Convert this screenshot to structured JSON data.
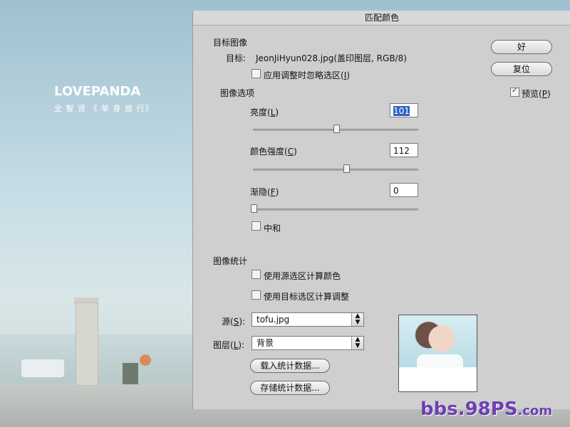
{
  "background": {
    "brand": "LOVEPANDA",
    "brand_sub": "全 智 贤  《 单 身 旅 行》"
  },
  "dialog": {
    "title": "匹配颜色",
    "target_section": "目标图像",
    "target_label": "目标:",
    "target_value": "JeonJiHyun028.jpg(盖印图层, RGB/8)",
    "ignore_selection_label": "应用调整时忽略选区(",
    "ignore_selection_key": "I",
    "image_options_section": "图像选项",
    "brightness_label": "亮度(",
    "brightness_key": "L",
    "brightness_value": "101",
    "brightness_level": 0.5,
    "intensity_label": "颜色强度(",
    "intensity_key": "C",
    "intensity_value": "112",
    "intensity_level": 0.56,
    "fade_label": "渐隐(",
    "fade_key": "F",
    "fade_value": "0",
    "fade_level": 0,
    "neutralize_label": "中和",
    "stats_section": "图像统计",
    "use_source_sel_label": "使用源选区计算颜色",
    "use_target_sel_label": "使用目标选区计算调整",
    "source_label": "源(",
    "source_key": "S",
    "source_value": "tofu.jpg",
    "layer_label": "图层(",
    "layer_key": "L",
    "layer_value": "背景",
    "load_stats": "载入统计数据...",
    "save_stats": "存储统计数据...",
    "ok": "好",
    "reset": "复位",
    "preview_label": "预览(",
    "preview_key": "P",
    "paren_close": ")",
    "paren_close_colon": "):"
  },
  "watermark": {
    "text": "bbs.98PS",
    "domain": ".com"
  }
}
